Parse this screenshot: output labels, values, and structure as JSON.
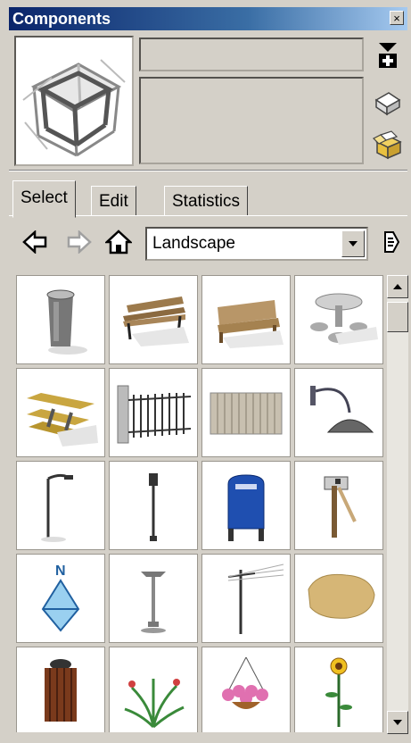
{
  "window": {
    "title": "Components",
    "close_glyph": "×"
  },
  "info": {
    "name_value": "",
    "description_value": ""
  },
  "side_buttons": [
    {
      "icon": "details-menu-icon"
    },
    {
      "icon": "create-component-icon"
    },
    {
      "icon": "open-component-icon"
    }
  ],
  "tabs": [
    {
      "label": "Select",
      "active": true
    },
    {
      "label": "Edit",
      "active": false
    },
    {
      "label": "Statistics",
      "active": false
    }
  ],
  "nav": {
    "back_icon": "back-arrow-icon",
    "forward_icon": "forward-arrow-icon",
    "home_icon": "home-icon",
    "collection_value": "Landscape",
    "menu_icon": "details-arrow-icon"
  },
  "components": [
    "trash-can",
    "park-bench",
    "wood-bench",
    "table-umbrella",
    "picnic-table",
    "iron-fence",
    "wood-fence",
    "wall-lamp",
    "street-lamp",
    "lamp-post",
    "mailbox",
    "post-mailbox",
    "north-arrow",
    "patio-heater",
    "utility-pole",
    "rock",
    "waste-bin",
    "palm-plant",
    "hanging-basket",
    "sunflower"
  ],
  "colors": {
    "titlebar_start": "#0a246a",
    "titlebar_end": "#a6caf0",
    "panel": "#d4d0c8"
  }
}
